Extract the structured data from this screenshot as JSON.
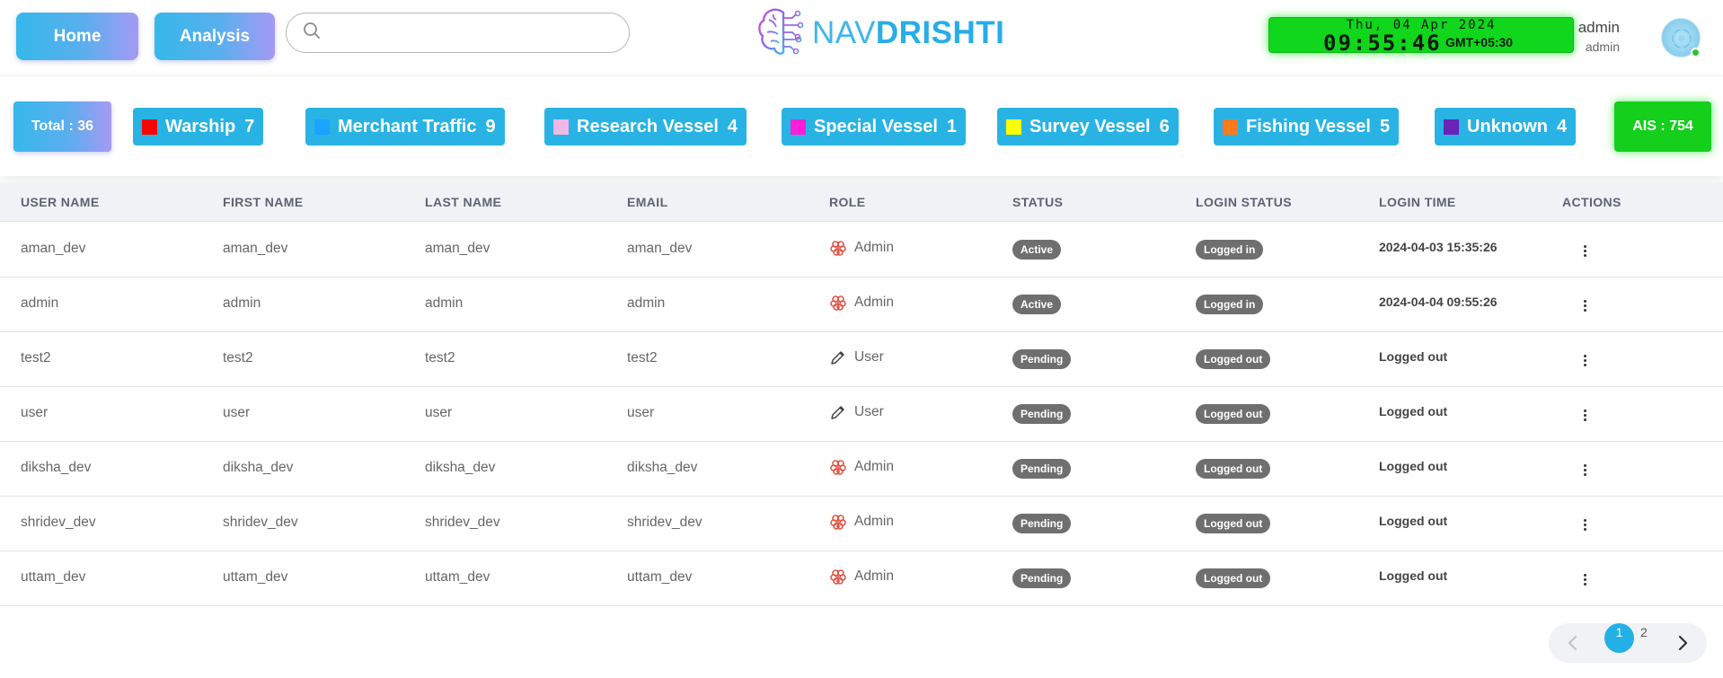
{
  "header": {
    "home_label": "Home",
    "analysis_label": "Analysis",
    "search_placeholder": "",
    "logo_nav": "NAV",
    "logo_drishti": "DRISHTI",
    "clock_date": "Thu, 04 Apr 2024",
    "clock_time": "09:55:46",
    "clock_tz": "GMT+05:30",
    "user_name": "admin",
    "user_role": "admin"
  },
  "stats": {
    "total": "Total : 36",
    "ais": "AIS : 754",
    "chips": [
      {
        "label": "Warship",
        "count": "7",
        "color": "#ff0000"
      },
      {
        "label": "Merchant Traffic",
        "count": "9",
        "color": "#1aa3ff"
      },
      {
        "label": "Research Vessel",
        "count": "4",
        "color": "#f0b8e6"
      },
      {
        "label": "Special Vessel",
        "count": "1",
        "color": "#ff1fd8"
      },
      {
        "label": "Survey Vessel",
        "count": "6",
        "color": "#ffff00"
      },
      {
        "label": "Fishing Vessel",
        "count": "5",
        "color": "#ff7a1a"
      },
      {
        "label": "Unknown",
        "count": "4",
        "color": "#6a22b8"
      }
    ]
  },
  "table": {
    "headers": [
      "USER NAME",
      "FIRST NAME",
      "LAST NAME",
      "EMAIL",
      "ROLE",
      "STATUS",
      "LOGIN STATUS",
      "LOGIN TIME",
      "ACTIONS"
    ],
    "rows": [
      {
        "username": "aman_dev",
        "first": "aman_dev",
        "last": "aman_dev",
        "email": "aman_dev",
        "role": "Admin",
        "role_icon": "admin-brain-icon",
        "status": "Active",
        "login_status": "Logged in",
        "login_time": "2024-04-03 15:35:26"
      },
      {
        "username": "admin",
        "first": "admin",
        "last": "admin",
        "email": "admin",
        "role": "Admin",
        "role_icon": "admin-brain-icon",
        "status": "Active",
        "login_status": "Logged in",
        "login_time": "2024-04-04 09:55:26"
      },
      {
        "username": "test2",
        "first": "test2",
        "last": "test2",
        "email": "test2",
        "role": "User",
        "role_icon": "pencil-icon",
        "status": "Pending",
        "login_status": "Logged out",
        "login_time": "Logged out"
      },
      {
        "username": "user",
        "first": "user",
        "last": "user",
        "email": "user",
        "role": "User",
        "role_icon": "pencil-icon",
        "status": "Pending",
        "login_status": "Logged out",
        "login_time": "Logged out"
      },
      {
        "username": "diksha_dev",
        "first": "diksha_dev",
        "last": "diksha_dev",
        "email": "diksha_dev",
        "role": "Admin",
        "role_icon": "admin-brain-icon",
        "status": "Pending",
        "login_status": "Logged out",
        "login_time": "Logged out"
      },
      {
        "username": "shridev_dev",
        "first": "shridev_dev",
        "last": "shridev_dev",
        "email": "shridev_dev",
        "role": "Admin",
        "role_icon": "admin-brain-icon",
        "status": "Pending",
        "login_status": "Logged out",
        "login_time": "Logged out"
      },
      {
        "username": "uttam_dev",
        "first": "uttam_dev",
        "last": "uttam_dev",
        "email": "uttam_dev",
        "role": "Admin",
        "role_icon": "admin-brain-icon",
        "status": "Pending",
        "login_status": "Logged out",
        "login_time": "Logged out"
      }
    ]
  },
  "pagination": {
    "pages": [
      "1",
      "2"
    ],
    "current": "1"
  }
}
